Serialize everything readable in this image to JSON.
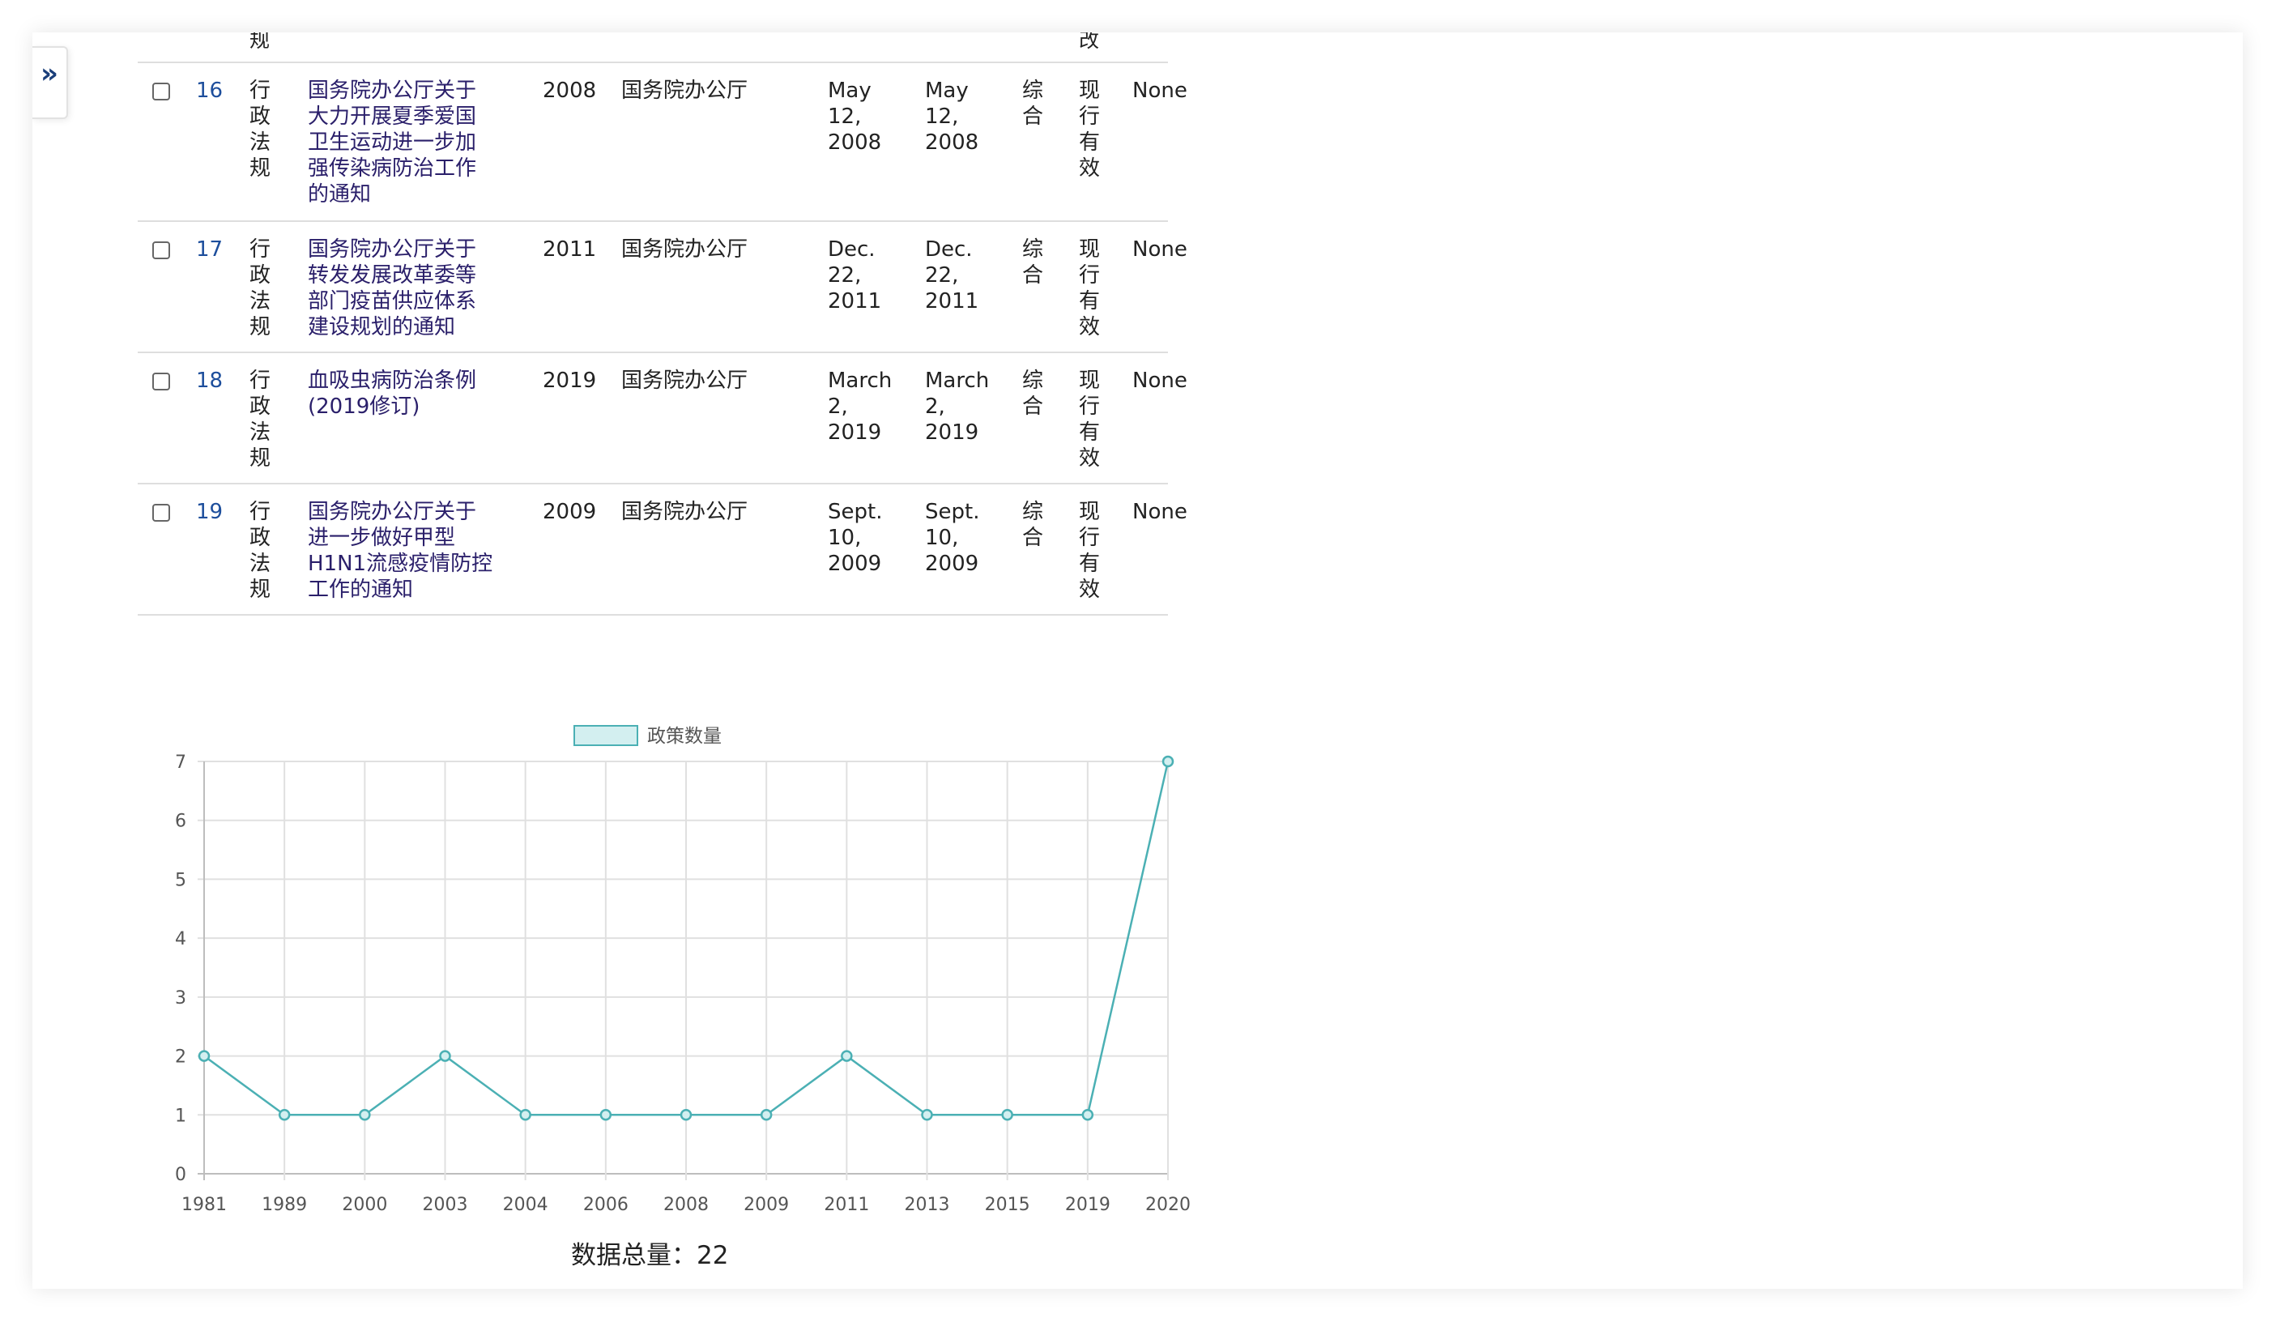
{
  "sidebar": {
    "toggle_label": "»"
  },
  "cut_row": {
    "type_tail": "规",
    "status_tail": "改"
  },
  "rows": [
    {
      "index": "16",
      "type": "行政法规",
      "title": "国务院办公厅关于大力开展夏季爱国卫生运动进一步加强传染病防治工作的通知",
      "title_lines": [
        "国务院办公厅关于",
        "大力开展夏季爱国",
        "卫生运动进一步加",
        "强传染病防治工作",
        "的通知"
      ],
      "year": "2008",
      "org": "国务院办公厅",
      "pub_date": [
        "May",
        "12,",
        "2008"
      ],
      "eff_date": [
        "May",
        "12,",
        "2008"
      ],
      "category": "综合",
      "status": "现行有效",
      "extra": "None"
    },
    {
      "index": "17",
      "type": "行政法规",
      "title": "国务院办公厅关于转发发展改革委等部门疫苗供应体系建设规划的通知",
      "title_lines": [
        "国务院办公厅关于",
        "转发发展改革委等",
        "部门疫苗供应体系",
        "建设规划的通知"
      ],
      "year": "2011",
      "org": "国务院办公厅",
      "pub_date": [
        "Dec.",
        "22,",
        "2011"
      ],
      "eff_date": [
        "Dec.",
        "22,",
        "2011"
      ],
      "category": "综合",
      "status": "现行有效",
      "extra": "None"
    },
    {
      "index": "18",
      "type": "行政法规",
      "title": "血吸虫病防治条例(2019修订)",
      "title_lines": [
        "血吸虫病防治条例",
        "(2019修订)"
      ],
      "year": "2019",
      "org": "国务院办公厅",
      "pub_date": [
        "March",
        "2,",
        "2019"
      ],
      "eff_date": [
        "March",
        "2,",
        "2019"
      ],
      "category": "综合",
      "status": "现行有效",
      "extra": "None"
    },
    {
      "index": "19",
      "type": "行政法规",
      "title": "国务院办公厅关于进一步做好甲型H1N1流感疫情防控工作的通知",
      "title_lines": [
        "国务院办公厅关于",
        "进一步做好甲型",
        "H1N1流感疫情防控",
        "工作的通知"
      ],
      "year": "2009",
      "org": "国务院办公厅",
      "pub_date": [
        "Sept.",
        "10,",
        "2009"
      ],
      "eff_date": [
        "Sept.",
        "10,",
        "2009"
      ],
      "category": "综合",
      "status": "现行有效",
      "extra": "None"
    }
  ],
  "chart_data": {
    "type": "line",
    "title": "",
    "xlabel": "",
    "ylabel": "",
    "categories": [
      "1981",
      "1989",
      "2000",
      "2003",
      "2004",
      "2006",
      "2008",
      "2009",
      "2011",
      "2013",
      "2015",
      "2019",
      "2020"
    ],
    "series": [
      {
        "name": "政策数量",
        "values": [
          2,
          1,
          1,
          2,
          1,
          1,
          1,
          1,
          2,
          1,
          1,
          1,
          7
        ]
      }
    ],
    "ylim": [
      0,
      7
    ],
    "yticks": [
      0,
      1,
      2,
      3,
      4,
      5,
      6,
      7
    ],
    "grid": true,
    "legend": "top-center",
    "colors": {
      "line": "#4bb0b4",
      "fill": "#d3eff0",
      "grid": "#e0e0e0"
    }
  },
  "summary": {
    "total_label": "数据总量：22"
  }
}
